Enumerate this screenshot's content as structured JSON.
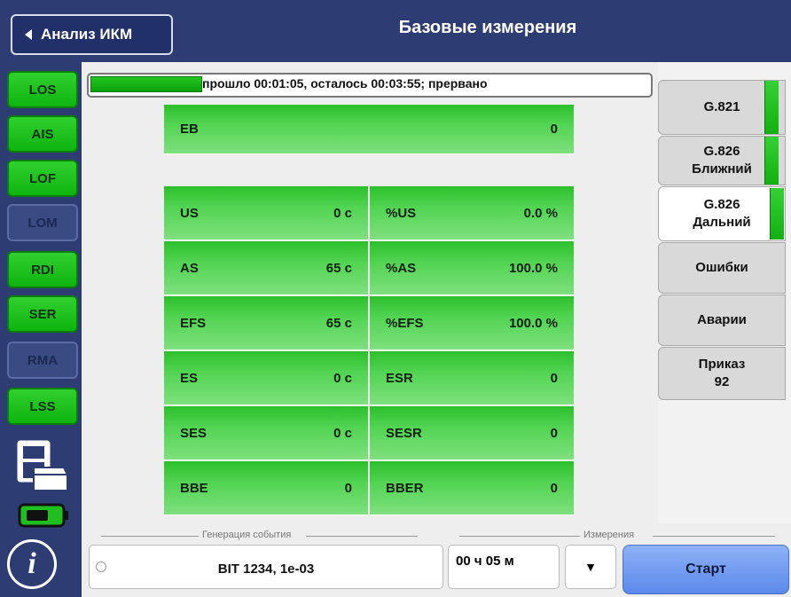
{
  "header": {
    "back_label": "Анализ ИКМ",
    "title": "Базовые измерения"
  },
  "alarms": [
    {
      "label": "LOS",
      "state": "green"
    },
    {
      "label": "AIS",
      "state": "green"
    },
    {
      "label": "LOF",
      "state": "green"
    },
    {
      "label": "LOM",
      "state": "off"
    },
    {
      "label": "RDI",
      "state": "green"
    },
    {
      "label": "SER",
      "state": "green"
    },
    {
      "label": "RMA",
      "state": "off"
    },
    {
      "label": "LSS",
      "state": "green"
    }
  ],
  "progress": {
    "text": "прошло 00:01:05, осталось 00:03:55; прервано",
    "fraction": 0.2
  },
  "eb": {
    "label": "EB",
    "value": "0"
  },
  "rows": [
    {
      "l_label": "US",
      "l_value": "0 с",
      "r_label": "%US",
      "r_value": "0.0 %"
    },
    {
      "l_label": "AS",
      "l_value": "65 с",
      "r_label": "%AS",
      "r_value": "100.0 %"
    },
    {
      "l_label": "EFS",
      "l_value": "65 с",
      "r_label": "%EFS",
      "r_value": "100.0 %"
    },
    {
      "l_label": "ES",
      "l_value": "0 с",
      "r_label": "ESR",
      "r_value": "0"
    },
    {
      "l_label": "SES",
      "l_value": "0 с",
      "r_label": "SESR",
      "r_value": "0"
    },
    {
      "l_label": "BBE",
      "l_value": "0",
      "r_label": "BBER",
      "r_value": "0"
    }
  ],
  "tabs": [
    {
      "line1": "G.821",
      "line2": ""
    },
    {
      "line1": "G.826",
      "line2": "Ближний"
    },
    {
      "line1": "G.826",
      "line2": "Дальний"
    },
    {
      "line1": "Ошибки",
      "line2": ""
    },
    {
      "line1": "Аварии",
      "line2": ""
    },
    {
      "line1": "Приказ",
      "line2": "92"
    }
  ],
  "bottom": {
    "event_legend": "Генерация события",
    "event_text": "BIT  1234, 1e-03",
    "measure_legend": "Измерения",
    "duration": "00 ч 05 м",
    "dropdown_symbol": "▼",
    "start_label": "Старт"
  },
  "icons": {
    "info": "i"
  },
  "colors": {
    "accent_green": "#17b917",
    "header_blue": "#2d3c72",
    "start_blue": "#6f9af0"
  }
}
